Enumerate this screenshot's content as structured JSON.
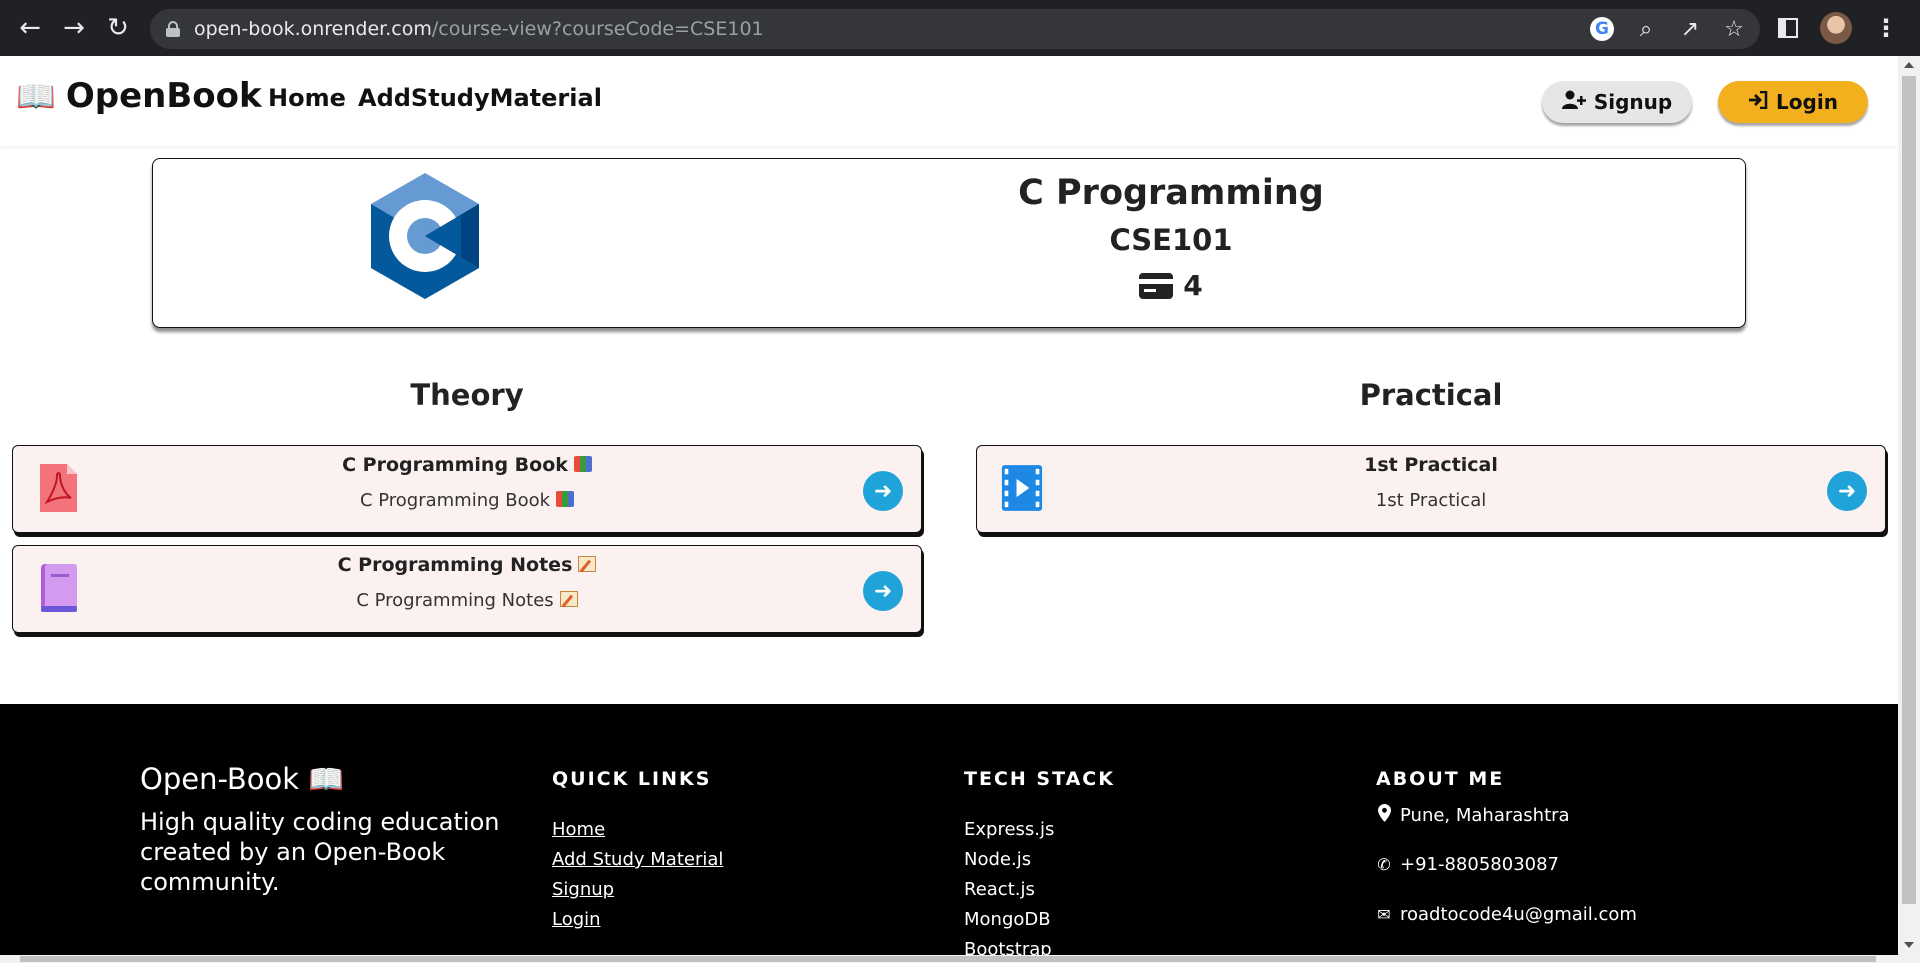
{
  "browser": {
    "url_host": "open-book.onrender.com",
    "url_path": "/course-view?courseCode=CSE101"
  },
  "navbar": {
    "brand": "OpenBook",
    "links": [
      "Home",
      "AddStudyMaterial"
    ],
    "signup_label": "Signup",
    "login_label": "Login",
    "login_color": "#f2b01e"
  },
  "course": {
    "title": "C Programming",
    "code": "CSE101",
    "credits": "4"
  },
  "sections": {
    "theory": {
      "title": "Theory",
      "items": [
        {
          "title": "C Programming Book",
          "subtitle": "C Programming Book",
          "icon": "pdf-icon"
        },
        {
          "title": "C Programming Notes",
          "subtitle": "C Programming Notes",
          "icon": "notebook-icon"
        }
      ]
    },
    "practical": {
      "title": "Practical",
      "items": [
        {
          "title": "1st Practical",
          "subtitle": "1st Practical",
          "icon": "video-icon"
        }
      ]
    }
  },
  "footer": {
    "brand": "Open-Book",
    "tagline": "High quality coding education created by an Open-Book community.",
    "quick_links": {
      "heading": "QUICK LINKS",
      "items": [
        "Home",
        "Add Study Material",
        "Signup",
        "Login"
      ]
    },
    "tech_stack": {
      "heading": "TECH STACK",
      "items": [
        "Express.js",
        "Node.js",
        "React.js",
        "MongoDB",
        "Bootstrap"
      ]
    },
    "about": {
      "heading": "ABOUT ME",
      "location": "Pune, Maharashtra",
      "phone": "+91-8805803087",
      "email": "roadtocode4u@gmail.com"
    }
  }
}
